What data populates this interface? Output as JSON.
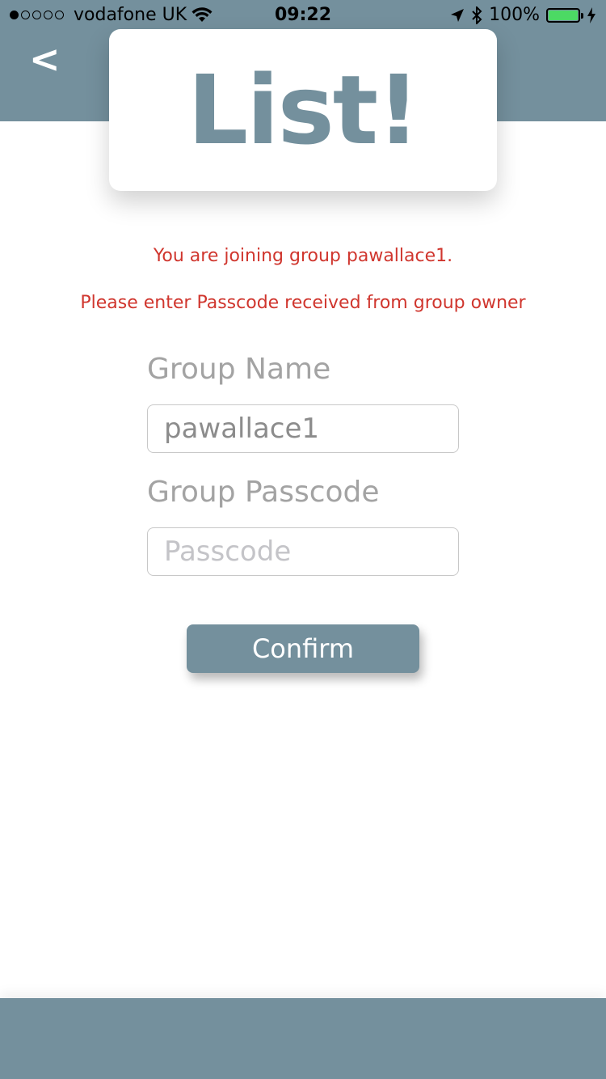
{
  "status_bar": {
    "carrier": "vodafone UK",
    "time": "09:22",
    "battery": "100%",
    "battery_level": 1.0,
    "signal_bars": 1,
    "signal_total": 5
  },
  "header": {
    "back_label": "<",
    "logo": "List!"
  },
  "messages": {
    "joining": "You are joining group pawallace1.",
    "instruction": "Please enter Passcode received from group owner"
  },
  "form": {
    "group_name_label": "Group Name",
    "group_name_value": "pawallace1",
    "group_passcode_label": "Group Passcode",
    "group_passcode_placeholder": "Passcode",
    "confirm_label": "Confirm"
  },
  "colors": {
    "brand": "#74909d",
    "error_text": "#d0362e",
    "battery_fill": "#4cd964"
  }
}
